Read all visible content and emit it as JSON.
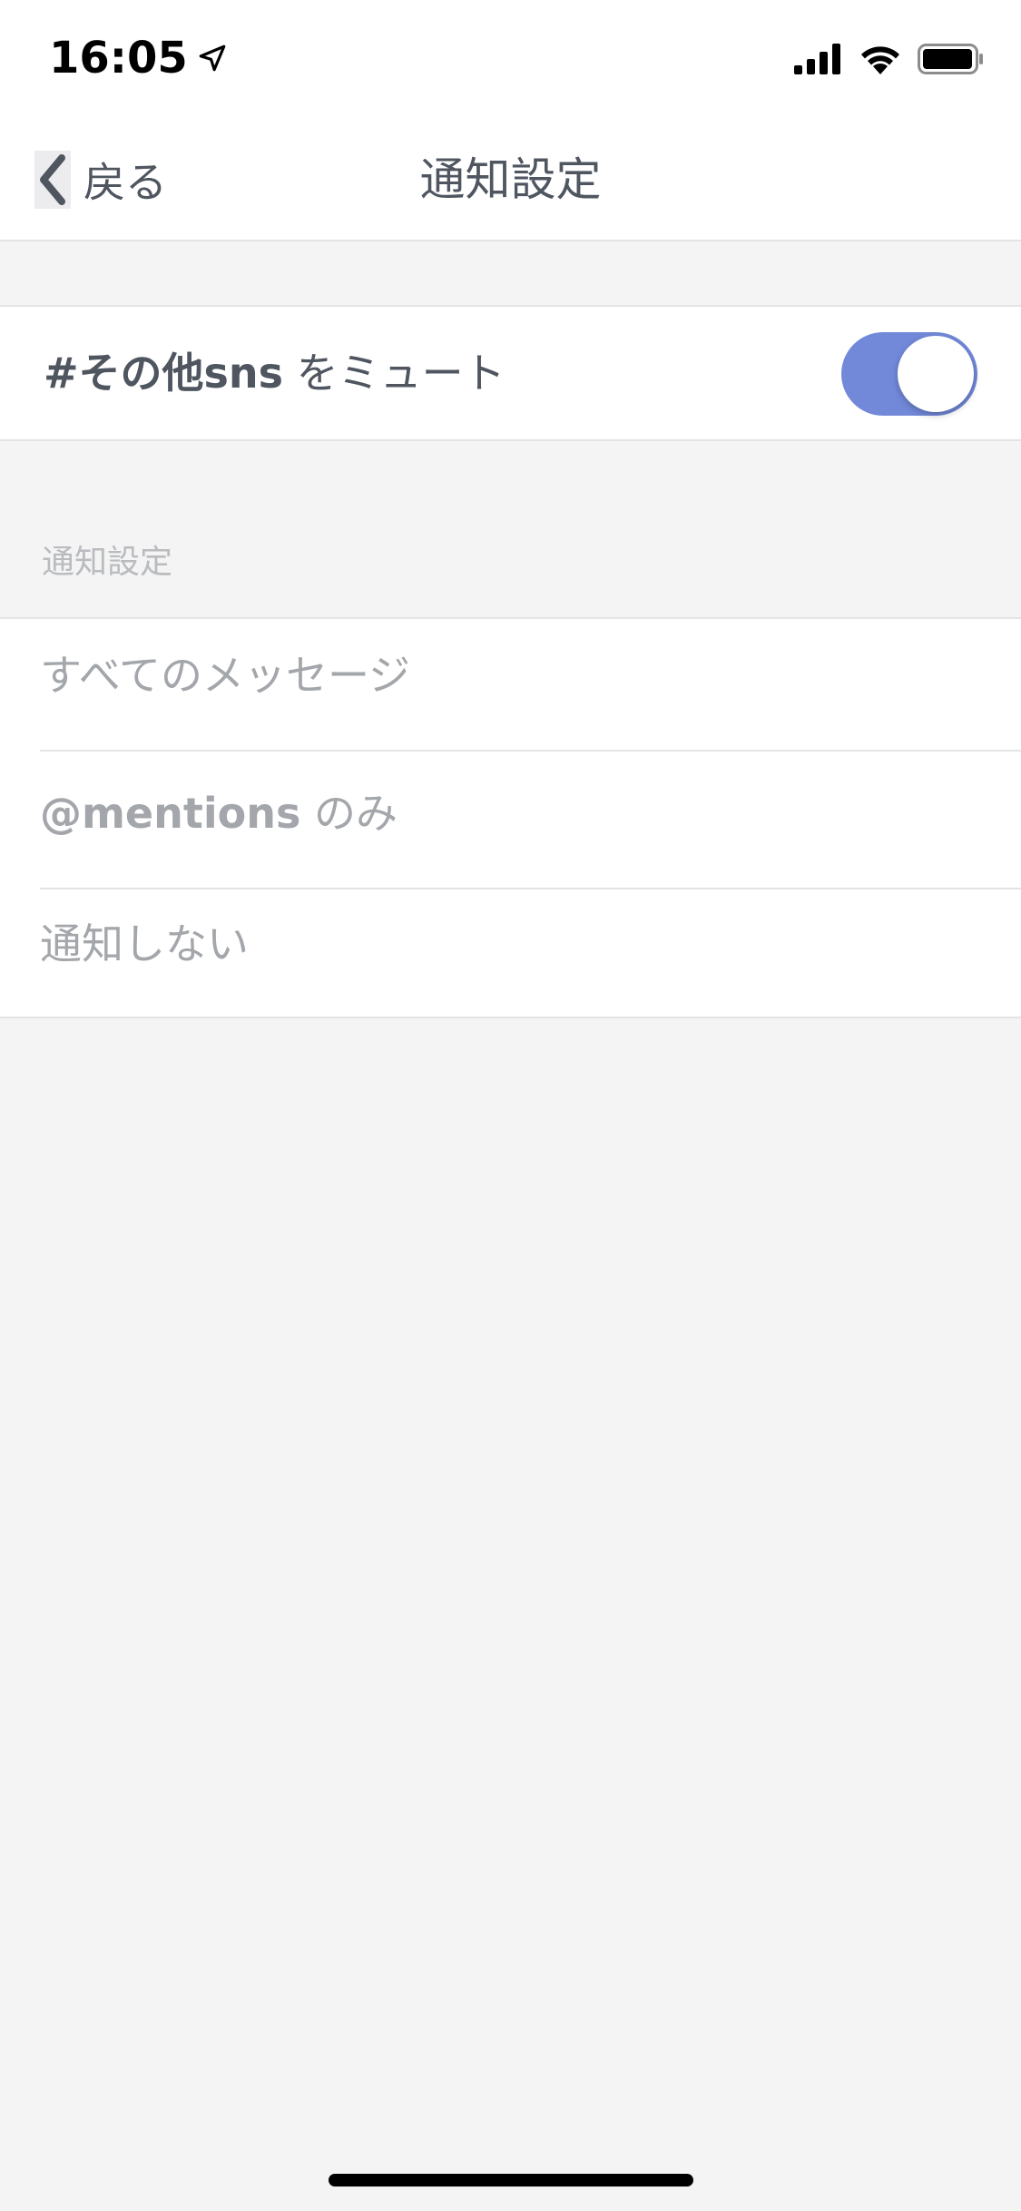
{
  "status_bar": {
    "time": "16:05",
    "icons": [
      "location-arrow-icon",
      "cellular-signal-icon",
      "wifi-icon",
      "battery-icon"
    ]
  },
  "nav": {
    "back_label": "戻る",
    "title": "通知設定"
  },
  "mute": {
    "channel": "#その他sns",
    "suffix": " をミュート",
    "enabled": true
  },
  "section": {
    "header": "通知設定"
  },
  "options": [
    {
      "prefix": "",
      "label": "すべてのメッセージ"
    },
    {
      "prefix": "@mentions",
      "label": " のみ"
    },
    {
      "prefix": "",
      "label": "通知しない"
    }
  ],
  "colors": {
    "accent": "#7289da",
    "text_primary": "#4f5660",
    "text_muted": "#a3a6aa",
    "background": "#f4f4f5"
  }
}
